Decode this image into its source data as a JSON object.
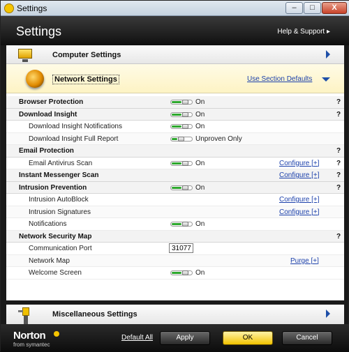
{
  "window": {
    "title": "Settings",
    "min_glyph": "–",
    "max_glyph": "□",
    "close_glyph": "X"
  },
  "header": {
    "title": "Settings",
    "help": "Help & Support ▸"
  },
  "sections": {
    "computer": "Computer Settings",
    "network": "Network Settings",
    "network_defaults": "Use Section Defaults",
    "misc": "Miscellaneous Settings"
  },
  "rows": {
    "browser_protection": {
      "label": "Browser Protection",
      "value": "On",
      "help": "?"
    },
    "download_insight": {
      "label": "Download Insight",
      "value": "On",
      "help": "?"
    },
    "di_notifications": {
      "label": "Download Insight Notifications",
      "value": "On"
    },
    "di_full_report": {
      "label": "Download Insight Full Report",
      "value": "Unproven Only"
    },
    "email_protection": {
      "label": "Email Protection",
      "help": "?"
    },
    "email_antivirus": {
      "label": "Email Antivirus Scan",
      "value": "On",
      "configure": "Configure [+]",
      "help": "?"
    },
    "im_scan": {
      "label": "Instant Messenger Scan",
      "configure": "Configure [+]",
      "help": "?"
    },
    "intrusion_prevention": {
      "label": "Intrusion Prevention",
      "value": "On",
      "help": "?"
    },
    "intrusion_autoblock": {
      "label": "Intrusion AutoBlock",
      "configure": "Configure [+]"
    },
    "intrusion_signatures": {
      "label": "Intrusion Signatures",
      "configure": "Configure [+]"
    },
    "notifications": {
      "label": "Notifications",
      "value": "On"
    },
    "network_security_map": {
      "label": "Network Security Map",
      "help": "?"
    },
    "communication_port": {
      "label": "Communication Port",
      "value": "31077"
    },
    "network_map": {
      "label": "Network Map",
      "purge": "Purge [+]"
    },
    "welcome_screen": {
      "label": "Welcome Screen",
      "value": "On"
    }
  },
  "footer": {
    "logo": "Norton",
    "logo_sub": "from symantec",
    "default_all": "Default All",
    "apply": "Apply",
    "ok": "OK",
    "cancel": "Cancel"
  },
  "colors": {
    "accent": "#1e4fa8",
    "toggle_on": "#2da82d",
    "link": "#1a3faa",
    "ok_button": "#f2c300"
  }
}
